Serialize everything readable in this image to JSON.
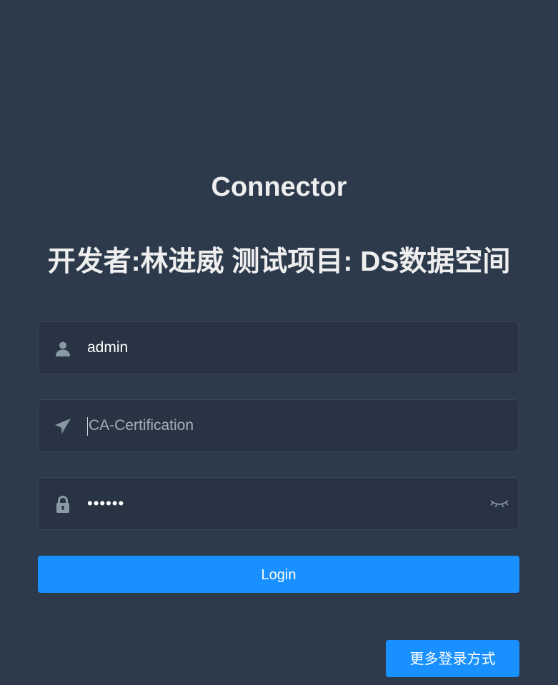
{
  "header": {
    "title": "Connector",
    "subtitle": "开发者:林进威 测试项目: DS数据空间"
  },
  "form": {
    "username": {
      "value": "admin",
      "icon": "user-icon"
    },
    "certification": {
      "value": "",
      "placeholder": "CA-Certification",
      "icon": "paper-plane-icon"
    },
    "password": {
      "masked_value": "••••••",
      "icon": "lock-icon",
      "toggle_icon": "eye-closed-icon"
    }
  },
  "actions": {
    "login_label": "Login",
    "more_login_label": "更多登录方式"
  },
  "colors": {
    "background": "#2d3a4b",
    "input_background": "#283443",
    "primary": "#1890ff",
    "icon": "#889aa4",
    "title": "#eeeeee"
  }
}
